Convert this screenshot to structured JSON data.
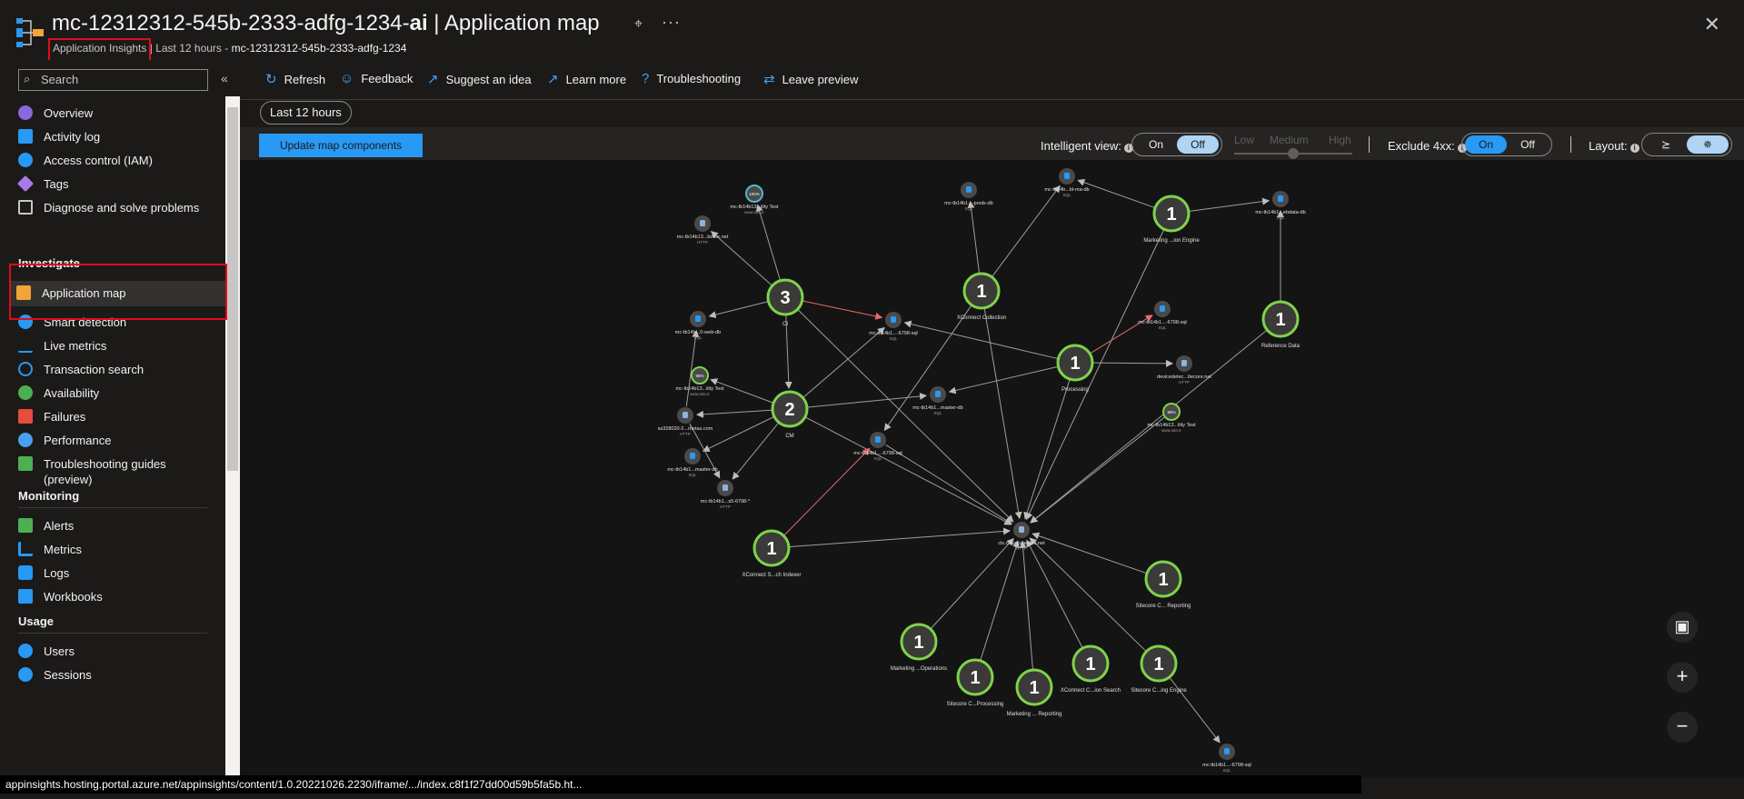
{
  "header": {
    "title_prefix": "mc-12312312-545b-2333-adfg-1234-",
    "title_bold": "ai",
    "title_suffix": " | Application map",
    "subtitle_service": "Application Insights",
    "subtitle_time": " | Last 12 hours - ",
    "subtitle_resource": "mc-12312312-545b-2333-adfg-1234",
    "pin_icon": "pin-icon",
    "more_label": "···",
    "close_label": "✕"
  },
  "sidebar": {
    "search_placeholder": "Search",
    "collapse_label": "«",
    "items": [
      {
        "label": "Overview",
        "icon": "overview-icon",
        "color": "#8a6ad8"
      },
      {
        "label": "Activity log",
        "icon": "activity-log-icon",
        "color": "#2899f5"
      },
      {
        "label": "Access control (IAM)",
        "icon": "access-control-icon",
        "color": "#2899f5"
      },
      {
        "label": "Tags",
        "icon": "tags-icon",
        "color": "#a77ce6"
      },
      {
        "label": "Diagnose and solve problems",
        "icon": "wrench-icon",
        "color": "#c8c6c4"
      }
    ],
    "section_investigate": "Investigate",
    "investigate_items": [
      {
        "label": "Application map",
        "icon": "application-map-icon",
        "color": "#f2a33a"
      },
      {
        "label": "Smart detection",
        "icon": "smart-detection-icon",
        "color": "#2899f5"
      },
      {
        "label": "Live metrics",
        "icon": "live-metrics-icon",
        "color": "#2899f5"
      },
      {
        "label": "Transaction search",
        "icon": "transaction-search-icon",
        "color": "#2899f5"
      },
      {
        "label": "Availability",
        "icon": "availability-icon",
        "color": "#4cb050"
      },
      {
        "label": "Failures",
        "icon": "failures-icon",
        "color": "#e84c3d"
      },
      {
        "label": "Performance",
        "icon": "performance-icon",
        "color": "#4aa0f0"
      },
      {
        "label": "Troubleshooting guides",
        "label2": "(preview)",
        "icon": "troubleshooting-guides-icon",
        "color": "#4cb050"
      }
    ],
    "section_monitoring": "Monitoring",
    "monitoring_items": [
      {
        "label": "Alerts",
        "icon": "alerts-icon",
        "color": "#4cb050"
      },
      {
        "label": "Metrics",
        "icon": "metrics-icon",
        "color": "#2899f5"
      },
      {
        "label": "Logs",
        "icon": "logs-icon",
        "color": "#2899f5"
      },
      {
        "label": "Workbooks",
        "icon": "workbooks-icon",
        "color": "#2899f5"
      }
    ],
    "section_usage": "Usage",
    "usage_items": [
      {
        "label": "Users",
        "icon": "users-icon",
        "color": "#2899f5"
      },
      {
        "label": "Sessions",
        "icon": "sessions-icon",
        "color": "#2899f5"
      }
    ]
  },
  "toolbar": {
    "refresh": "Refresh",
    "feedback": "Feedback",
    "suggest": "Suggest an idea",
    "learn": "Learn more",
    "troubleshooting": "Troubleshooting",
    "leave_preview": "Leave preview"
  },
  "filters": {
    "time_range": "Last 12 hours",
    "update_button": "Update map components",
    "intelligent_view": "Intelligent view:",
    "on": "On",
    "off": "Off",
    "low": "Low",
    "medium": "Medium",
    "high": "High",
    "exclude_4xx": "Exclude 4xx:",
    "layout": "Layout:"
  },
  "map": {
    "nodes": [
      {
        "id": "ci",
        "count": "3",
        "label": "CI"
      },
      {
        "id": "cm",
        "count": "2",
        "label": "CM"
      },
      {
        "id": "xcollect",
        "count": "1",
        "label": "XConnect Collection"
      },
      {
        "id": "mktengine",
        "count": "1",
        "label": "Marketing ...ion Engine"
      },
      {
        "id": "refdata",
        "count": "1",
        "label": "Reference Data"
      },
      {
        "id": "processing",
        "count": "1",
        "label": "Processing"
      },
      {
        "id": "xindexer",
        "count": "1",
        "label": "XConnect S...ch Indexer"
      },
      {
        "id": "screporting",
        "count": "1",
        "label": "Sitecore C... Reporting"
      },
      {
        "id": "mktops",
        "count": "1",
        "label": "Marketing ...Operations"
      },
      {
        "id": "scprocessing",
        "count": "1",
        "label": "Sitecore C...Processing"
      },
      {
        "id": "mktreporting",
        "count": "1",
        "label": "Marketing ... Reporting"
      },
      {
        "id": "xsearch",
        "count": "1",
        "label": "XConnect C...ion Search"
      },
      {
        "id": "scengine",
        "count": "1",
        "label": "Sitecore C...ing Engine"
      }
    ],
    "deps": [
      {
        "id": "avail1",
        "label": "mc-tb14b13...ility Test",
        "sub": "www.site.tr",
        "badge": "100%"
      },
      {
        "id": "lbotee",
        "label": "mc-tb14b13...botee.net",
        "sub": "HTTP"
      },
      {
        "id": "pools",
        "label": "mc-tb14b1...-pools-db",
        "sub": "SQL"
      },
      {
        "id": "ma1",
        "label": "mc-tb14b...bl-ma-db",
        "sub": "SQL"
      },
      {
        "id": "rdata",
        "label": "mc-tb14b1...ebdata-db",
        "sub": "SQL"
      },
      {
        "id": "sqlA",
        "label": "mc-tb14b1...-6798-sql",
        "sub": "SQL"
      },
      {
        "id": "webdb",
        "label": "mc-tb14b...0-web-db",
        "sub": "SQL"
      },
      {
        "id": "sqlB",
        "label": "mc-tb14b1...-6798-sql",
        "sub": "SQL"
      },
      {
        "id": "devicedetect",
        "label": "devicedetec...ttecore.net",
        "sub": "HTTP"
      },
      {
        "id": "avail2",
        "label": "mc-tb14b13...ility Test",
        "sub": "www.site.tr",
        "badge": "98%"
      },
      {
        "id": "master1",
        "label": "mc-tb14b1...master-db",
        "sub": "SQL"
      },
      {
        "id": "ss1",
        "label": "ss328020-2...rbetas.com",
        "sub": "HTTP"
      },
      {
        "id": "avail3",
        "label": "mc-tb14b13...ility Test",
        "sub": "www.site.tr",
        "badge": "96%"
      },
      {
        "id": "sqlC",
        "label": "mc-tb14b1...-6798-sql",
        "sub": "SQL"
      },
      {
        "id": "master2",
        "label": "mc-tb14b1...master-db",
        "sub": "SQL"
      },
      {
        "id": "st6798",
        "label": "mc-tb14b1...s5-6798-*",
        "sub": "HTTP"
      },
      {
        "id": "cloudsite",
        "label": "cls.cloud.sitecore.net",
        "sub": "HTTP"
      },
      {
        "id": "sqlD",
        "label": "mc-tb14b1...-6798-sql",
        "sub": "SQL"
      }
    ]
  },
  "zoom": {
    "fit": "fit-to-screen-icon",
    "in": "+",
    "out": "−"
  },
  "status_bar": "appinsights.hosting.portal.azure.net/appinsights/content/1.0.20221026.2230/iframe/.../index.c8f1f27dd00d59b5fa5b.ht..."
}
